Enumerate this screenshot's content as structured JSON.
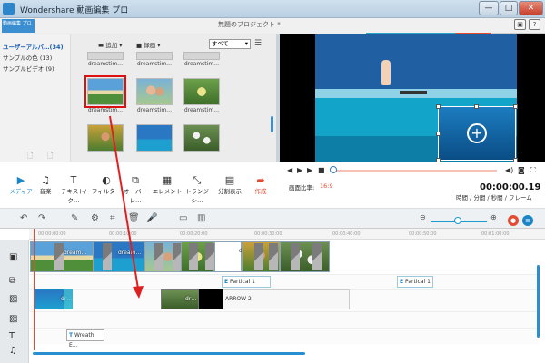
{
  "window": {
    "title": "Wondershare 動画編集 プロ",
    "buttons": {
      "minimize": "—",
      "maximize": "□",
      "close": "✕"
    }
  },
  "header": {
    "logo_text": "動画編集 プロ",
    "project_title": "無題のプロジェクト *"
  },
  "sidebar": {
    "items": [
      {
        "label": "ユーザーアルバ…",
        "count": "(34)"
      },
      {
        "label": "サンプルの色",
        "count": "(13)"
      },
      {
        "label": "サンプルビデオ",
        "count": "(9)"
      }
    ]
  },
  "library": {
    "add_label": "追加",
    "record_label": "録画",
    "filter_value": "すべて",
    "thumb_caption": "dreamstim…"
  },
  "toolbar": {
    "media": "メディア",
    "music": "音楽",
    "text": "テキスト/ク…",
    "filter": "フィルター",
    "overlay": "オーバーレ…",
    "element": "エレメント",
    "transition": "トランジシ…",
    "split_screen": "分割表示",
    "create": "作成"
  },
  "player": {
    "ratio_label": "画面比率:",
    "ratio_value": "16:9",
    "timecode": "00:00:00.19",
    "timecode_format": "時間 / 分間 / 秒間 / フレーム"
  },
  "timeline": {
    "ruler_ticks": [
      "00:00:00:00",
      "00:00:10:00",
      "00:00:20:00",
      "00:00:30:00",
      "00:00:40:00",
      "00:00:50:00",
      "00:01:00:00"
    ],
    "clip_dream": "dream…",
    "clip_dr": "dr…",
    "element_1": "Partical 1",
    "element_2": "Partical 1",
    "arrow2": "ARROW 2",
    "text_clip": "Wreath E…"
  },
  "colors": {
    "accent_blue": "#1b86c6",
    "accent_red": "#e44a32",
    "highlight_red": "#dd1111"
  }
}
